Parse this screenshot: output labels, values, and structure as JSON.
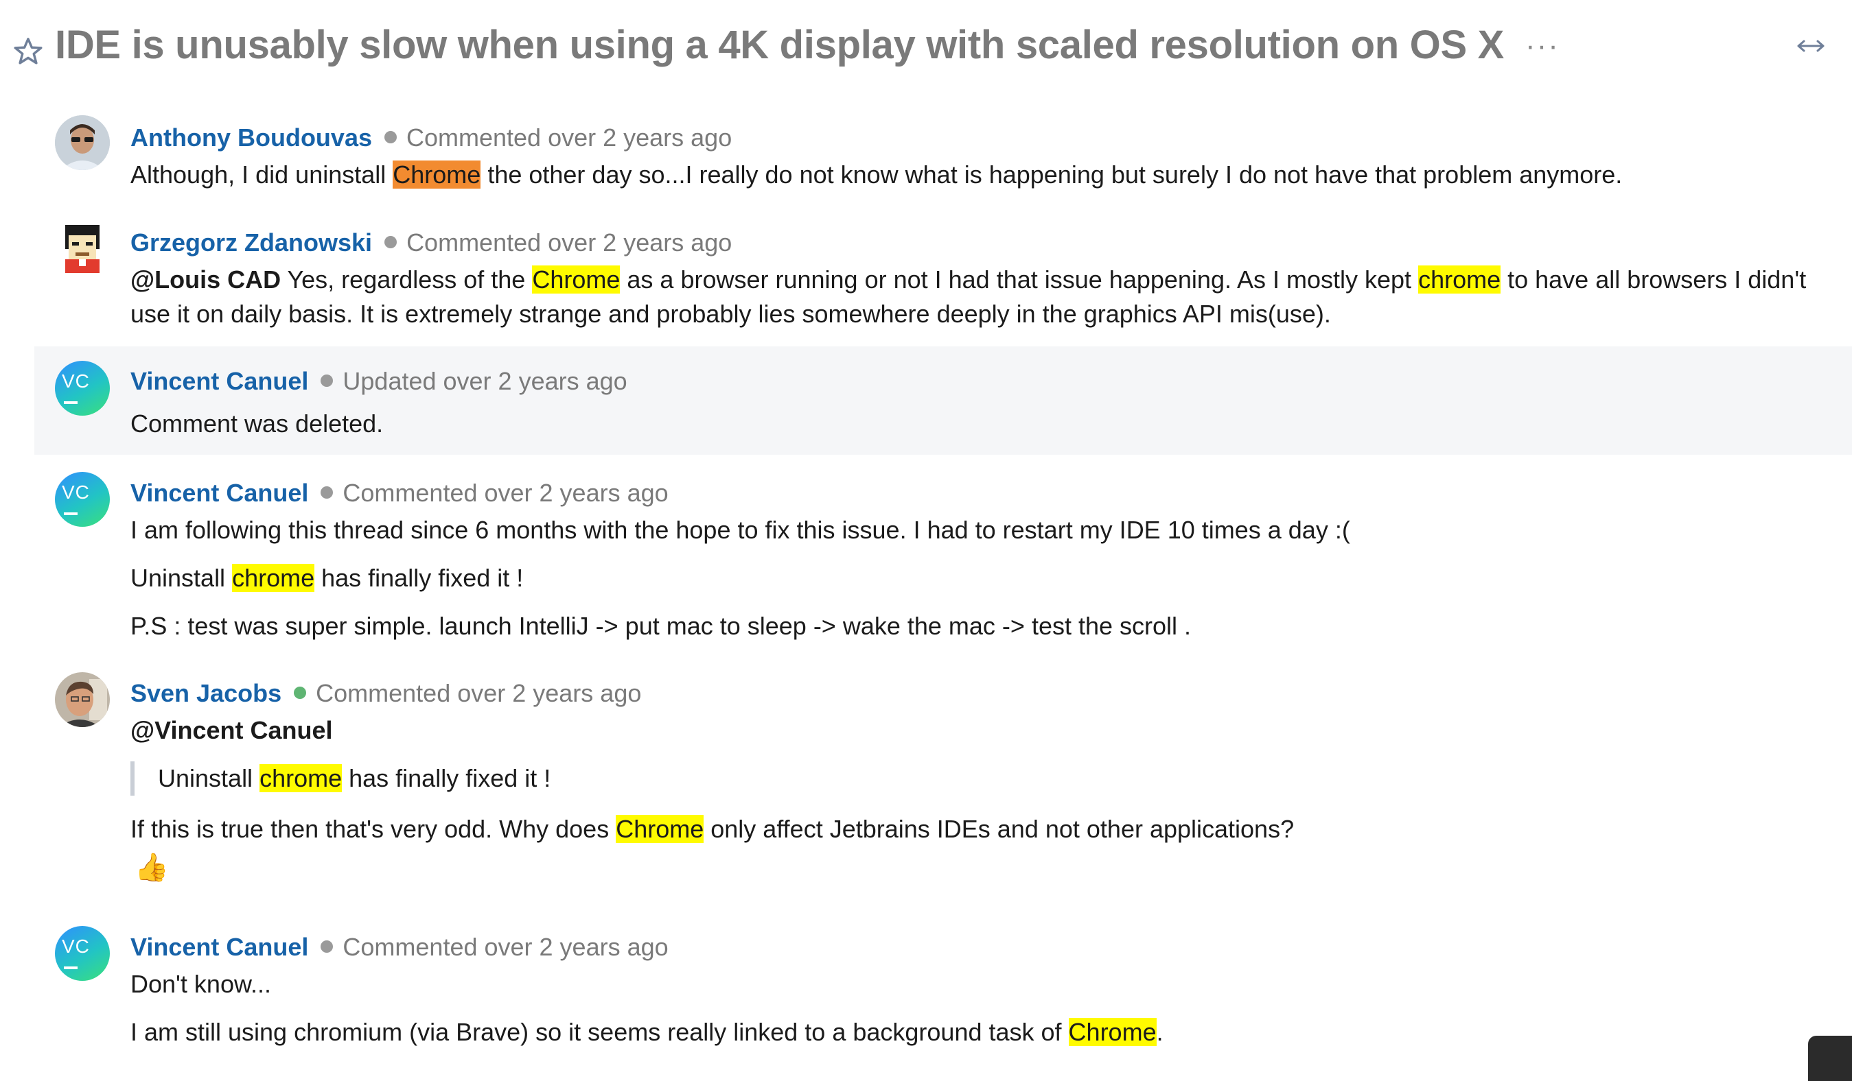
{
  "issue": {
    "title": "IDE is unusably slow when using a 4K display with scaled resolution on OS X",
    "more_label": "···"
  },
  "comments": [
    {
      "author": "Anthony Boudouvas",
      "meta": "Commented over 2 years ago",
      "lines": [
        {
          "pre": "Although, I did uninstall ",
          "hl": "Chrome",
          "post": " the other day so...I really do not know what is happening but surely I do not have that problem anymore."
        }
      ]
    },
    {
      "author": "Grzegorz Zdanowski",
      "meta": "Commented over 2 years ago",
      "mention": "@Louis CAD",
      "text_a": " Yes, regardless of the ",
      "hl_a": "Chrome",
      "text_b": " as a browser running or not I had that issue happening. As I mostly kept ",
      "hl_b": "chrome",
      "text_c": " to have all browsers I didn't",
      "text_d": "use it on daily basis. It is extremely strange and probably lies somewhere deeply in the graphics API mis(use)."
    },
    {
      "author": "Vincent Canuel",
      "initials": "VC",
      "meta": "Updated over 2 years ago",
      "body": "Comment was deleted."
    },
    {
      "author": "Vincent Canuel",
      "initials": "VC",
      "meta": "Commented over 2 years ago",
      "p1": "I am following this thread since 6 months with the hope to fix this issue. I had to restart my IDE 10 times a day :(",
      "p2_pre": "Uninstall ",
      "p2_hl": "chrome",
      "p2_post": " has finally fixed it !",
      "p3": "P.S : test was super simple. launch IntelliJ -> put mac to sleep -> wake the mac -> test the scroll ."
    },
    {
      "author": "Sven Jacobs",
      "meta": "Commented over 2 years ago",
      "mention": "@Vincent Canuel",
      "quote_pre": "Uninstall ",
      "quote_hl": "chrome",
      "quote_post": " has finally fixed it !",
      "p_pre": "If this is true then that's very odd. Why does ",
      "p_hl": "Chrome",
      "p_post": " only affect Jetbrains IDEs and not other applications?",
      "reaction": "👍"
    },
    {
      "author": "Vincent Canuel",
      "initials": "VC",
      "meta": "Commented over 2 years ago",
      "p1": "Don't know...",
      "p2_pre": "I am still using chromium (via Brave) so it seems really linked to a background task of ",
      "p2_hl": "Chrome",
      "p2_post": "."
    }
  ],
  "colors": {
    "author": "#1762a8",
    "highlight": "#fffb00",
    "current_highlight": "#f28b30",
    "online": "#5fb573"
  }
}
